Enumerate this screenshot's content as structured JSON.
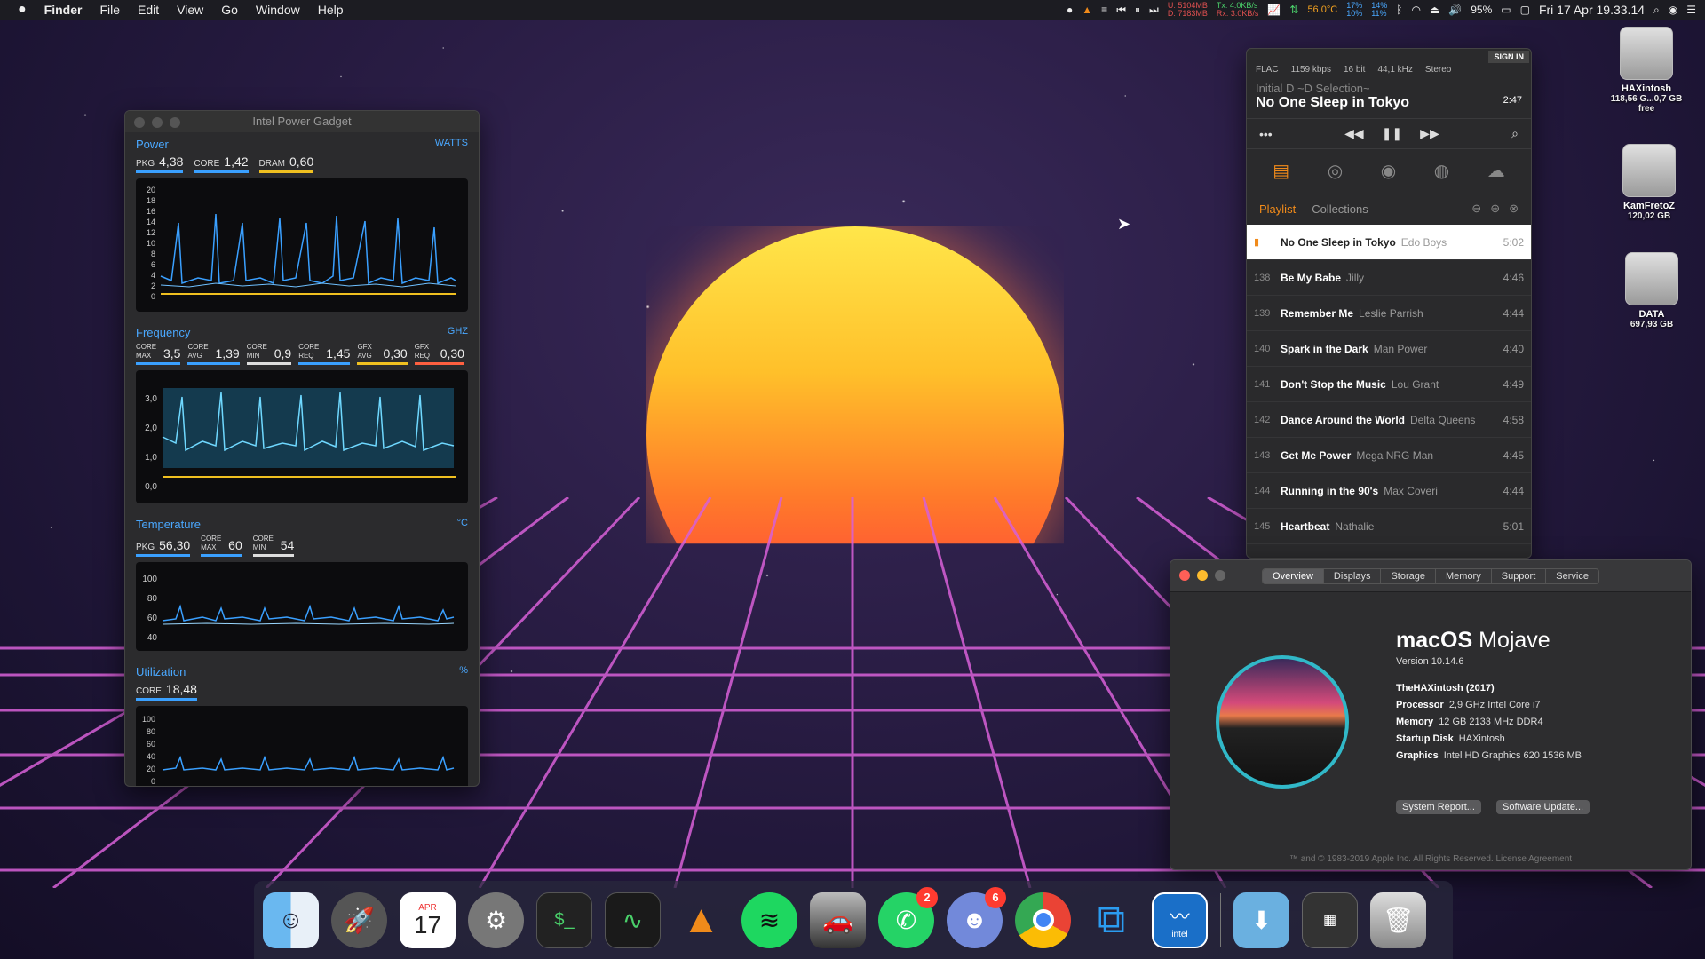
{
  "menubar": {
    "app": "Finder",
    "menus": [
      "File",
      "Edit",
      "View",
      "Go",
      "Window",
      "Help"
    ],
    "net": {
      "up_label": "U:",
      "up": "5104MB",
      "down_label": "D:",
      "down": "7183MB",
      "tx_label": "Tx:",
      "tx": "4.0KB/s",
      "rx_label": "Rx:",
      "rx": "3.0KB/s"
    },
    "temp": "56.0°C",
    "cpu1": "17%",
    "cpu2": "10%",
    "mem1": "14%",
    "mem2": "11%",
    "battery": "95%",
    "datetime": "Fri 17 Apr  19.33.14"
  },
  "power_gadget": {
    "title": "Intel Power Gadget",
    "power": {
      "title": "Power",
      "unit": "WATTS",
      "metrics": [
        {
          "label": "PKG",
          "value": "4,38",
          "color": "#3aa0ff"
        },
        {
          "label": "CORE",
          "value": "1,42",
          "color": "#3aa0ff"
        },
        {
          "label": "DRAM",
          "value": "0,60",
          "color": "#f0c020"
        }
      ],
      "yticks": [
        "20",
        "18",
        "16",
        "14",
        "12",
        "10",
        "8",
        "6",
        "4",
        "2",
        "0"
      ]
    },
    "frequency": {
      "title": "Frequency",
      "unit": "GHZ",
      "metrics": [
        {
          "label": "CORE MAX",
          "value": "3,5",
          "color": "#3aa0ff"
        },
        {
          "label": "CORE AVG",
          "value": "1,39",
          "color": "#3aa0ff"
        },
        {
          "label": "CORE MIN",
          "value": "0,9",
          "color": "#ddd"
        },
        {
          "label": "CORE REQ",
          "value": "1,45",
          "color": "#3aa0ff"
        },
        {
          "label": "GFX AVG",
          "value": "0,30",
          "color": "#f0c020"
        },
        {
          "label": "GFX REQ",
          "value": "0,30",
          "color": "#ff6040"
        }
      ],
      "yticks": [
        "3,0",
        "2,0",
        "1,0",
        "0,0"
      ]
    },
    "temperature": {
      "title": "Temperature",
      "unit": "°C",
      "metrics": [
        {
          "label": "PKG",
          "value": "56,30",
          "color": "#3aa0ff"
        },
        {
          "label": "CORE MAX",
          "value": "60",
          "color": "#3aa0ff"
        },
        {
          "label": "CORE MIN",
          "value": "54",
          "color": "#ddd"
        }
      ],
      "yticks": [
        "100",
        "80",
        "60",
        "40"
      ]
    },
    "utilization": {
      "title": "Utilization",
      "unit": "%",
      "metrics": [
        {
          "label": "CORE",
          "value": "18,48",
          "color": "#3aa0ff"
        }
      ],
      "yticks": [
        "100",
        "80",
        "60",
        "40",
        "20",
        "0"
      ]
    }
  },
  "music_player": {
    "sign_in": "SIGN IN",
    "format": [
      "FLAC",
      "1159 kbps",
      "16 bit",
      "44,1 kHz",
      "Stereo"
    ],
    "album": "Initial D ~D Selection~",
    "song": "No One Sleep in Tokyo",
    "time": "2:47",
    "tabs": {
      "playlist": "Playlist",
      "collections": "Collections"
    },
    "tracks": [
      {
        "num": "",
        "title": "No One Sleep in Tokyo",
        "artist": "Edo Boys",
        "dur": "5:02"
      },
      {
        "num": "138",
        "title": "Be My Babe",
        "artist": "Jilly",
        "dur": "4:46"
      },
      {
        "num": "139",
        "title": "Remember Me",
        "artist": "Leslie Parrish",
        "dur": "4:44"
      },
      {
        "num": "140",
        "title": "Spark in the Dark",
        "artist": "Man Power",
        "dur": "4:40"
      },
      {
        "num": "141",
        "title": "Don't Stop the Music",
        "artist": "Lou Grant",
        "dur": "4:49"
      },
      {
        "num": "142",
        "title": "Dance Around the World",
        "artist": "Delta Queens",
        "dur": "4:58"
      },
      {
        "num": "143",
        "title": "Get Me Power",
        "artist": "Mega NRG Man",
        "dur": "4:45"
      },
      {
        "num": "144",
        "title": "Running in the 90's",
        "artist": "Max Coveri",
        "dur": "4:44"
      },
      {
        "num": "145",
        "title": "Heartbeat",
        "artist": "Nathalie",
        "dur": "5:01"
      }
    ]
  },
  "about": {
    "tabs": [
      "Overview",
      "Displays",
      "Storage",
      "Memory",
      "Support",
      "Service"
    ],
    "os_name": "macOS",
    "os_release": "Mojave",
    "version": "Version 10.14.6",
    "model": "TheHAXintosh (2017)",
    "specs": [
      {
        "label": "Processor",
        "value": "2,9 GHz Intel Core i7"
      },
      {
        "label": "Memory",
        "value": "12 GB 2133 MHz DDR4"
      },
      {
        "label": "Startup Disk",
        "value": "HAXintosh"
      },
      {
        "label": "Graphics",
        "value": "Intel HD Graphics 620 1536 MB"
      }
    ],
    "btn_report": "System Report...",
    "btn_update": "Software Update...",
    "copyright": "™ and © 1983-2019 Apple Inc. All Rights Reserved. License Agreement"
  },
  "drives": [
    {
      "name": "HAXintosh",
      "info": "118,56 G...0,7 GB free"
    },
    {
      "name": "KamFretoZ",
      "info": "120,02 GB"
    },
    {
      "name": "DATA",
      "info": "697,93 GB"
    }
  ],
  "dock": {
    "calendar_month": "APR",
    "calendar_day": "17",
    "whatsapp_badge": "2",
    "discord_badge": "6",
    "intel_label": "intel"
  }
}
